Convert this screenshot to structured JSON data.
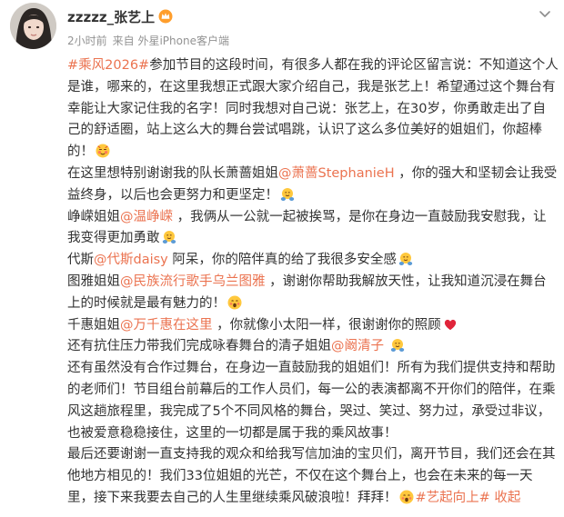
{
  "post": {
    "username": "zzzzz_张艺上",
    "meta": {
      "time": "2小时前",
      "source": "来自 外星iPhone客户端"
    },
    "paragraphs": [
      [
        {
          "type": "link",
          "text": "#乘风2026#"
        },
        {
          "type": "text",
          "text": "参加节目的这段时间，有很多人都在我的评论区留言说：不知道这个人是谁，哪来的，在这里我想正式跟大家介绍自己，我是张艺上！希望通过这个舞台有幸能让大家记住我的名字！同时我想对自己说：张艺上，在30岁，你勇敢走出了自己的舒适圈，站上这么大的舞台尝试唱跳，认识了这么多位美好的姐姐们，你超棒的！"
        },
        {
          "type": "emoji",
          "icon": "blush-emoji-icon"
        }
      ],
      [
        {
          "type": "text",
          "text": "在这里想特别谢谢我的队长萧蔷姐姐"
        },
        {
          "type": "link",
          "text": "@萧蔷StephanieH"
        },
        {
          "type": "text",
          "text": " ，你的强大和坚韧会让我受益终身，以后也会更努力和更坚定！"
        },
        {
          "type": "emoji",
          "icon": "hug-emoji-icon"
        }
      ],
      [
        {
          "type": "text",
          "text": "峥嵘姐姐"
        },
        {
          "type": "link",
          "text": "@温峥嵘"
        },
        {
          "type": "text",
          "text": " ，我俩从一公就一起被挨骂，是你在身边一直鼓励我安慰我，让我变得更加勇敢"
        },
        {
          "type": "emoji",
          "icon": "hug-emoji-icon"
        }
      ],
      [
        {
          "type": "text",
          "text": "代斯"
        },
        {
          "type": "link",
          "text": "@代斯daisy"
        },
        {
          "type": "text",
          "text": " 阿呆，你的陪伴真的给了我很多安全感"
        },
        {
          "type": "emoji",
          "icon": "hug-emoji-icon"
        }
      ],
      [
        {
          "type": "text",
          "text": "图雅姐姐"
        },
        {
          "type": "link",
          "text": "@民族流行歌手乌兰图雅"
        },
        {
          "type": "text",
          "text": " ，谢谢你帮助我解放天性，让我知道沉浸在舞台上的时候就是最有魅力的！"
        },
        {
          "type": "emoji",
          "icon": "shy-emoji-icon"
        }
      ],
      [
        {
          "type": "text",
          "text": "千惠姐姐"
        },
        {
          "type": "link",
          "text": "@万千惠在这里"
        },
        {
          "type": "text",
          "text": " ，你就像小太阳一样，很谢谢你的照顾"
        },
        {
          "type": "emoji",
          "icon": "heart-icon"
        }
      ],
      [
        {
          "type": "text",
          "text": "还有抗住压力带我们完成咏春舞台的清子姐姐"
        },
        {
          "type": "link",
          "text": "@阚清子"
        },
        {
          "type": "text",
          "text": " "
        },
        {
          "type": "emoji",
          "icon": "hug-emoji-icon"
        }
      ],
      [
        {
          "type": "text",
          "text": "还有虽然没有合作过舞台，在身边一直鼓励我的姐姐们！所有为我们提供支持和帮助的老师们！节目组台前幕后的工作人员们，每一公的表演都离不开你们的陪伴，在乘风这趟旅程里，我完成了5个不同风格的舞台，哭过、笑过、努力过，承受过非议，也被爱意稳稳接住，这里的一切都是属于我的乘风故事！"
        }
      ],
      [
        {
          "type": "text",
          "text": "最后还要谢谢一直支持我的观众和给我写信加油的宝贝们，离开节目，我们还会在其他地方相见的！我们33位姐姐的光芒，不仅在这个舞台上，也会在未来的每一天里，接下来我要去自己的人生里继续乘风破浪啦！拜拜！"
        },
        {
          "type": "emoji",
          "icon": "shy-emoji-icon"
        },
        {
          "type": "link",
          "text": "#艺起向上#"
        },
        {
          "type": "text",
          "text": " "
        },
        {
          "type": "collapse",
          "text": "收起"
        }
      ]
    ]
  },
  "colors": {
    "link": "#eb7350",
    "meta": "#939393",
    "text": "#333333"
  }
}
